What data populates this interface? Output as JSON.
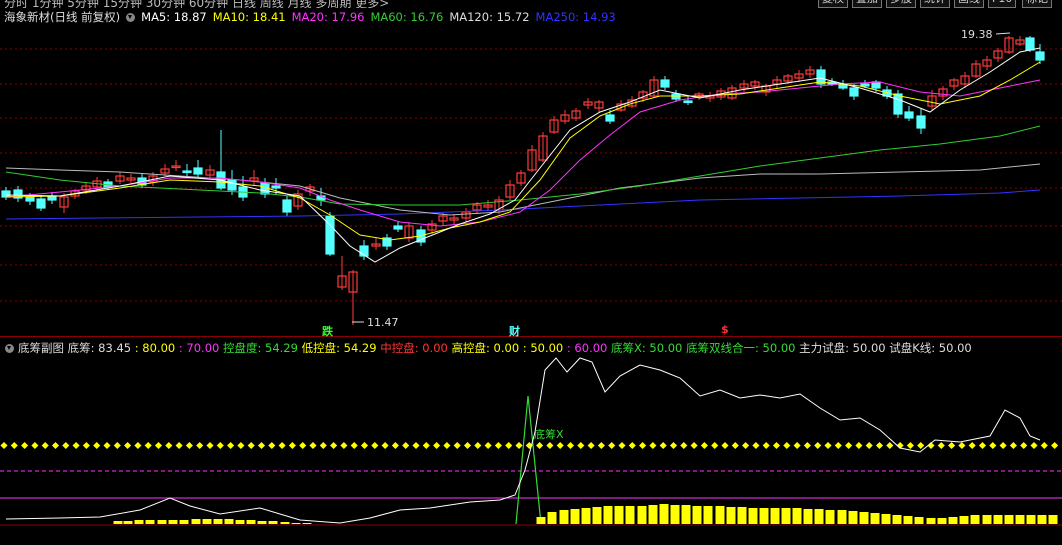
{
  "toolbar": {
    "periods_text": "分时 1分钟 5分钟 15分钟 30分钟 60分钟 日线 周线 月线 多周期 更多>",
    "buttons": [
      "复权",
      "叠加",
      "多股",
      "统计",
      "画线",
      "F10",
      "标记"
    ]
  },
  "main_legend": {
    "title": "海象新材(日线 前复权)",
    "ma5": "MA5: 18.87",
    "ma10": "MA10: 18.41",
    "ma20": "MA20: 17.96",
    "ma60": "MA60: 16.76",
    "ma120": "MA120: 15.72",
    "ma250": "MA250: 14.93"
  },
  "colors": {
    "ma5": "#ffffff",
    "ma10": "#ffff00",
    "ma20": "#ff33ff",
    "ma60": "#33cc33",
    "ma120": "#bbbbbb",
    "ma250": "#3333ff",
    "up": "#ff3b3b",
    "down": "#54ffff",
    "grid": "#8b0000"
  },
  "price_labels": {
    "high": "19.38",
    "low": "11.47"
  },
  "markers": {
    "die": "跌",
    "cai": "财",
    "dollar": "$"
  },
  "sub_legend": {
    "title": "底筹副图",
    "dichou": "底筹: 83.45",
    "v80": ": 80.00",
    "v70": ": 70.00",
    "kongpandu": "控盘度: 54.29",
    "dikongpan": "低控盘: 54.29",
    "zhongkongpan": "中控盘: 0.00",
    "gaokongpan": "高控盘: 0.00",
    "v50": ": 50.00",
    "v60": ": 60.00",
    "dichoux": "底筹X: 50.00",
    "shuangxian": "底筹双线合一: 50.00",
    "zhulishipan": "主力试盘: 50.00",
    "shipankxian": "试盘K线: 50.00"
  },
  "sub_label_dichoux": "底筹X"
}
